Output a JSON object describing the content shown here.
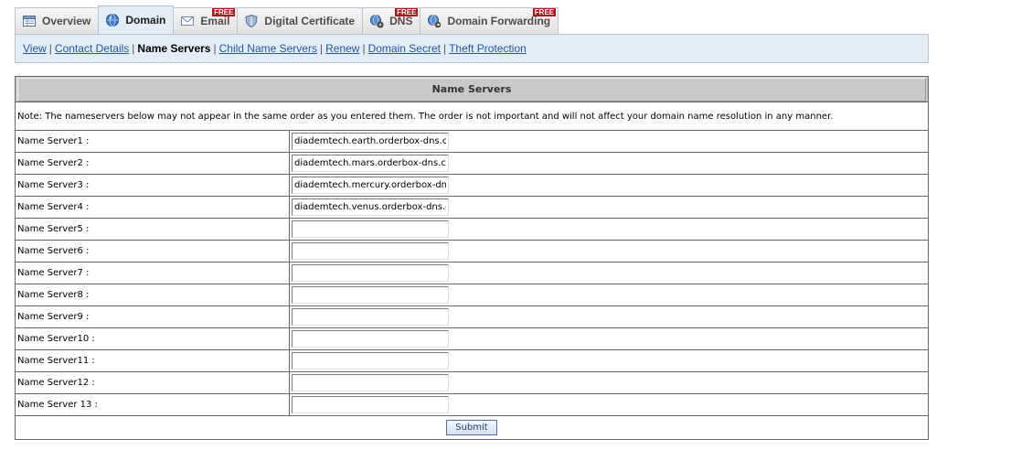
{
  "tabs": [
    {
      "label": "Overview",
      "icon": "overview-icon",
      "free": false,
      "active": false
    },
    {
      "label": "Domain",
      "icon": "globe-icon",
      "free": false,
      "active": true
    },
    {
      "label": "Email",
      "icon": "envelope-icon",
      "free": true,
      "active": false
    },
    {
      "label": "Digital Certificate",
      "icon": "shield-icon",
      "free": false,
      "active": false
    },
    {
      "label": "DNS",
      "icon": "dns-icon",
      "free": true,
      "active": false
    },
    {
      "label": "Domain Forwarding",
      "icon": "forwarding-icon",
      "free": true,
      "active": false
    }
  ],
  "free_badge": "FREE",
  "subnav": {
    "items": [
      "View",
      "Contact Details",
      "Name Servers",
      "Child Name Servers",
      "Renew",
      "Domain Secret",
      "Theft Protection"
    ],
    "current": "Name Servers",
    "separator": "|"
  },
  "section": {
    "title": "Name Servers",
    "note": "Note: The nameservers below may not appear in the same order as you entered them. The order is not important and will not affect your domain name resolution in any manner."
  },
  "name_servers": [
    {
      "label": "Name Server1 :",
      "value": "diademtech.earth.orderbox-dns.co"
    },
    {
      "label": "Name Server2 :",
      "value": "diademtech.mars.orderbox-dns.cor"
    },
    {
      "label": "Name Server3 :",
      "value": "diademtech.mercury.orderbox-dns."
    },
    {
      "label": "Name Server4 :",
      "value": "diademtech.venus.orderbox-dns.cc"
    },
    {
      "label": "Name Server5 :",
      "value": ""
    },
    {
      "label": "Name Server6 :",
      "value": ""
    },
    {
      "label": "Name Server7 :",
      "value": ""
    },
    {
      "label": "Name Server8 :",
      "value": ""
    },
    {
      "label": "Name Server9 :",
      "value": ""
    },
    {
      "label": "Name Server10 :",
      "value": ""
    },
    {
      "label": "Name Server11 :",
      "value": ""
    },
    {
      "label": "Name Server12 :",
      "value": ""
    },
    {
      "label": "Name Server 13 :",
      "value": ""
    }
  ],
  "submit_label": "Submit",
  "colors": {
    "tab_active_bg": "#e3edf7",
    "link": "#2257a8",
    "header_bg": "#c9c9c9",
    "free_badge": "#b3141a"
  }
}
